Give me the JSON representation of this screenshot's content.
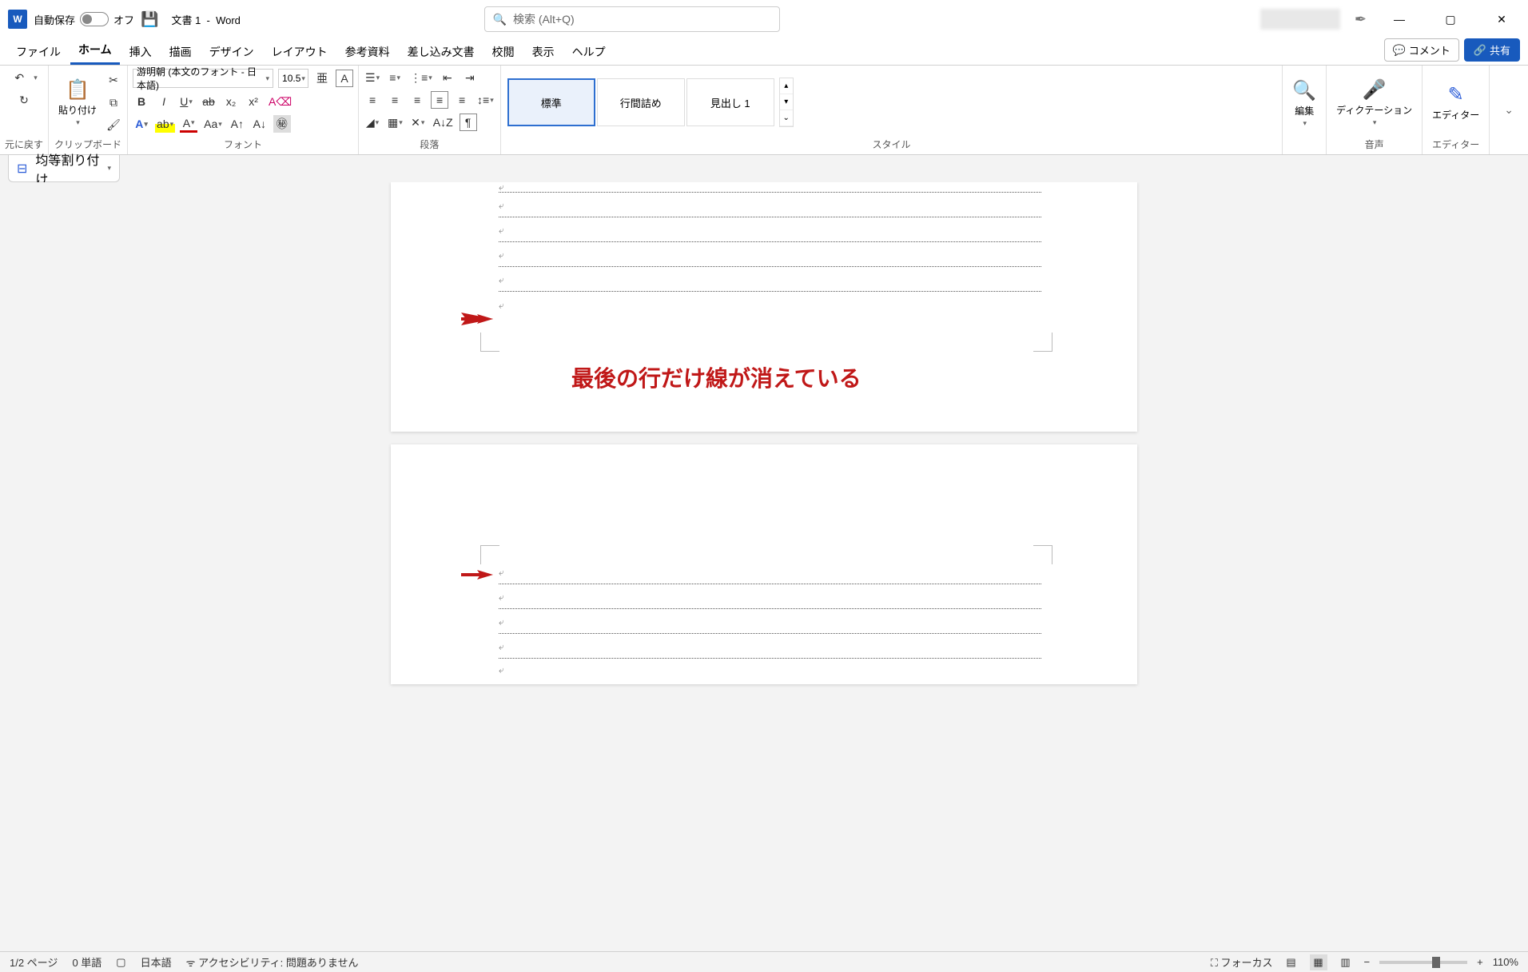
{
  "titlebar": {
    "autosave_label": "自動保存",
    "autosave_state": "オフ",
    "doc_title": "文書 1",
    "app_name": "Word",
    "search_placeholder": "検索 (Alt+Q)"
  },
  "tabs": {
    "items": [
      "ファイル",
      "ホーム",
      "挿入",
      "描画",
      "デザイン",
      "レイアウト",
      "参考資料",
      "差し込み文書",
      "校閲",
      "表示",
      "ヘルプ"
    ],
    "active_index": 1,
    "comment_label": "コメント",
    "share_label": "共有"
  },
  "ribbon": {
    "undo_group": "元に戻す",
    "clipboard_group": "クリップボード",
    "paste_label": "貼り付け",
    "font_group": "フォント",
    "font_name": "游明朝 (本文のフォント - 日本語)",
    "font_size": "10.5",
    "paragraph_group": "段落",
    "styles_group": "スタイル",
    "styles": [
      "標準",
      "行間詰め",
      "見出し 1"
    ],
    "edit_label": "編集",
    "dictate_label": "ディクテーション",
    "editor_label": "エディター",
    "voice_group": "音声",
    "editor_group": "エディター"
  },
  "qat2": {
    "distribute_label": "均等割り付け"
  },
  "annotation": {
    "text": "最後の行だけ線が消えている"
  },
  "statusbar": {
    "page": "1/2 ページ",
    "words": "0 単語",
    "lang": "日本語",
    "a11y": "アクセシビリティ: 問題ありません",
    "focus": "フォーカス",
    "zoom": "110%"
  }
}
